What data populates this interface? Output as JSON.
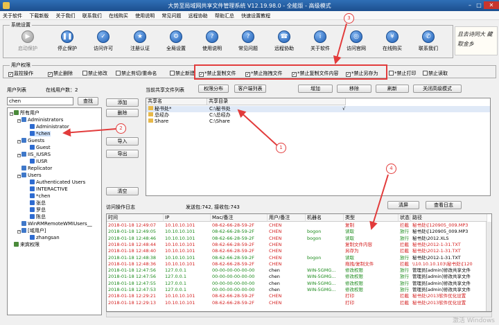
{
  "window": {
    "title": "大势至局域网共享文件管理系统 V12.19.98.0 - 全能版 - 高级模式",
    "min": "–",
    "max": "□",
    "close": "✕"
  },
  "menu": [
    "关于软件",
    "下载新版",
    "关于我们",
    "联系我们",
    "在线购买",
    "使用说明",
    "常见问题",
    "远程协助",
    "帮助汇总",
    "快速设置教程"
  ],
  "system_settings": {
    "label": "系统设置",
    "buttons": [
      {
        "label": "启动保护",
        "icon": "play-icon",
        "glyph": "▶",
        "disabled": true
      },
      {
        "label": "停止保护",
        "icon": "pause-icon",
        "glyph": "❚❚",
        "disabled": false
      },
      {
        "label": "访问许可",
        "icon": "access-icon",
        "glyph": "✓",
        "disabled": false
      },
      {
        "label": "注册认证",
        "icon": "register-icon",
        "glyph": "★",
        "disabled": false
      },
      {
        "label": "全局设置",
        "icon": "gear-icon",
        "glyph": "⚙",
        "disabled": false
      },
      {
        "label": "使用说明",
        "icon": "help-icon",
        "glyph": "?",
        "disabled": false
      },
      {
        "label": "常见问题",
        "icon": "question-icon",
        "glyph": "?",
        "disabled": false
      },
      {
        "label": "远程协助",
        "icon": "remote-icon",
        "glyph": "☎",
        "disabled": false
      },
      {
        "label": "关于软件",
        "icon": "info-icon",
        "glyph": "i",
        "disabled": false
      },
      {
        "label": "访问官网",
        "icon": "globe-icon",
        "glyph": "◎",
        "disabled": false
      },
      {
        "label": "在线购买",
        "icon": "cart-icon",
        "glyph": "¥",
        "disabled": false
      },
      {
        "label": "联系我们",
        "icon": "phone-icon",
        "glyph": "✆",
        "disabled": false
      }
    ],
    "calligraphy": "且去诗同大 藏取金乡"
  },
  "permissions": {
    "label": "用户权限",
    "items": [
      {
        "label": "监控操作",
        "checked": true
      },
      {
        "label": "禁止删除",
        "checked": true
      },
      {
        "label": "禁止修改",
        "checked": false
      },
      {
        "label": "禁止剪切/重命名",
        "checked": false
      },
      {
        "label": "禁止新建",
        "checked": false
      },
      {
        "label": "*禁止复制文件",
        "checked": true
      },
      {
        "label": "*禁止拖拽文件",
        "checked": true
      },
      {
        "label": "*禁止复制文件内容",
        "checked": true
      },
      {
        "label": "*禁止另存为",
        "checked": true
      },
      {
        "label": "*禁止打印",
        "checked": false
      },
      {
        "label": "禁止读取",
        "checked": false
      }
    ]
  },
  "users": {
    "label": "用户列表",
    "online": "在线用户数：2",
    "search_value": "chen",
    "search_button": "查找",
    "tree": [
      {
        "label": "所有用户",
        "level": 0,
        "type": "root",
        "toggle": "−"
      },
      {
        "label": "Administrators",
        "level": 1,
        "type": "grp",
        "toggle": "−"
      },
      {
        "label": "Administrator",
        "level": 2,
        "type": "usr",
        "toggle": ""
      },
      {
        "label": "*chen",
        "level": 2,
        "type": "usr",
        "toggle": ""
      },
      {
        "label": "Guests",
        "level": 1,
        "type": "grp",
        "toggle": "−"
      },
      {
        "label": "Guest",
        "level": 2,
        "type": "usr",
        "toggle": ""
      },
      {
        "label": "IIS_IUSRS",
        "level": 1,
        "type": "grp",
        "toggle": "−"
      },
      {
        "label": "IUSR",
        "level": 2,
        "type": "usr",
        "toggle": ""
      },
      {
        "label": "Replicator",
        "level": 1,
        "type": "grp",
        "toggle": ""
      },
      {
        "label": "Users",
        "level": 1,
        "type": "grp",
        "toggle": "−"
      },
      {
        "label": "Authenticated Users",
        "level": 2,
        "type": "usr",
        "toggle": ""
      },
      {
        "label": "INTERACTIVE",
        "level": 2,
        "type": "usr",
        "toggle": ""
      },
      {
        "label": "*chen",
        "level": 2,
        "type": "usr",
        "toggle": ""
      },
      {
        "label": "张总",
        "level": 2,
        "type": "usr",
        "toggle": ""
      },
      {
        "label": "罗总",
        "level": 2,
        "type": "usr",
        "toggle": ""
      },
      {
        "label": "陈总",
        "level": 2,
        "type": "usr",
        "toggle": ""
      },
      {
        "label": "WinRMRemoteWMIUsers__",
        "level": 1,
        "type": "grp",
        "toggle": ""
      },
      {
        "label": "[域用户]",
        "level": 1,
        "type": "grp",
        "toggle": "−"
      },
      {
        "label": "zhangsan",
        "level": 2,
        "type": "usr",
        "toggle": ""
      },
      {
        "label": "来宾权限",
        "level": 0,
        "type": "root",
        "toggle": ""
      }
    ]
  },
  "middle_buttons": [
    "添加",
    "删除",
    "导入",
    "导出",
    "清空"
  ],
  "shared": {
    "label": "当前共享文件列表",
    "top_buttons": [
      "权限分布",
      "客户端列表",
      "增加",
      "移除",
      "刷新",
      "关闭高级模式"
    ],
    "headers": [
      "共享名",
      "共享目录"
    ],
    "rows": [
      {
        "name": "秘书处*",
        "path": "C:\\秘书处",
        "checked": "√"
      },
      {
        "name": "总经办",
        "path": "C:\\总经办",
        "checked": ""
      },
      {
        "name": "Share",
        "path": "C:\\Share",
        "checked": ""
      }
    ]
  },
  "log": {
    "label": "访问操作日志",
    "stats": "发送包:742, 接收包:743",
    "buttons": [
      "清屏",
      "查看日志"
    ],
    "headers": [
      "时间",
      "IP",
      "Mac/备注",
      "用户/备注",
      "机器名",
      "类型",
      "状态",
      "路径"
    ],
    "rows": [
      [
        "2018-01-18 12:49:07",
        "10.10.10.101",
        "08-62-66-28-59-2F",
        "CHEN",
        "",
        "复制",
        "拦截",
        "秘书处\\[120905_009.MP3"
      ],
      [
        "2018-01-18 12:49:05",
        "10.10.10.101",
        "08-62-66-28-59-2F",
        "CHEN",
        "bogon",
        "读取",
        "放行",
        "秘书处\\[120905_009.MP3"
      ],
      [
        "2018-01-18 12:48:46",
        "10.10.10.101",
        "08-62-66-28-59-2F",
        "CHEN",
        "bogon",
        "读取",
        "放行",
        "秘书处\\2012.XLS"
      ],
      [
        "2018-01-18 12:48:44",
        "10.10.10.101",
        "08-62-66-28-59-2F",
        "CHEN",
        "",
        "复制文件内容",
        "拦截",
        "秘书处\\2012-1-31.TXT"
      ],
      [
        "2018-01-18 12:48:40",
        "10.10.10.101",
        "08-62-66-28-59-2F",
        "CHEN",
        "",
        "另存为",
        "拦截",
        "秘书处\\2012-1-31.TXT"
      ],
      [
        "2018-01-18 12:48:38",
        "10.10.10.101",
        "08-62-66-28-59-2F",
        "CHEN",
        "bogon",
        "读取",
        "放行",
        "秘书处\\2012-1-31.TXT"
      ],
      [
        "2018-01-18 12:48:36",
        "10.10.10.101",
        "08-62-66-28-59-2F",
        "CHEN",
        "",
        "拖拽/复制文件",
        "拦截",
        "\\\\10.10.10.103\\秘书处\\[120"
      ],
      [
        "2018-01-18 12:47:56",
        "127.0.0.1",
        "00-00-00-00-00-00",
        "chen",
        "WIN-5GMG...",
        "修改权限",
        "放行",
        "管理员[admin]修改共享文件"
      ],
      [
        "2018-01-18 12:47:56",
        "127.0.0.1",
        "00-00-00-00-00-00",
        "chen",
        "WIN-5GMG...",
        "修改权限",
        "放行",
        "管理员[admin]修改共享文件"
      ],
      [
        "2018-01-18 12:47:55",
        "127.0.0.1",
        "00-00-00-00-00-00",
        "chen",
        "WIN-5GMG...",
        "修改权限",
        "放行",
        "管理员[admin]修改共享文件"
      ],
      [
        "2018-01-18 12:47:53",
        "127.0.0.1",
        "00-00-00-00-00-00",
        "chen",
        "WIN-5GMG...",
        "修改权限",
        "放行",
        "管理员[admin]修改共享文件"
      ],
      [
        "2018-01-18 12:29:21",
        "10.10.10.101",
        "08-62-66-28-59-2F",
        "CHEN",
        "",
        "打印",
        "拦截",
        "秘书处\\2013软件优化设置"
      ],
      [
        "2018-01-18 12:29:13",
        "10.10.10.101",
        "08-62-66-28-59-2F",
        "CHEN",
        "",
        "打印",
        "拦截",
        "秘书处\\2013软件优化设置"
      ]
    ]
  },
  "annotations": [
    "1",
    "2",
    "3",
    "4"
  ],
  "watermark": "激活 Windows",
  "colors": {
    "accent": "#1f5fb5",
    "blocked": "#d42020",
    "allowed": "#1a8a1a",
    "annotation": "#e23b3b"
  }
}
